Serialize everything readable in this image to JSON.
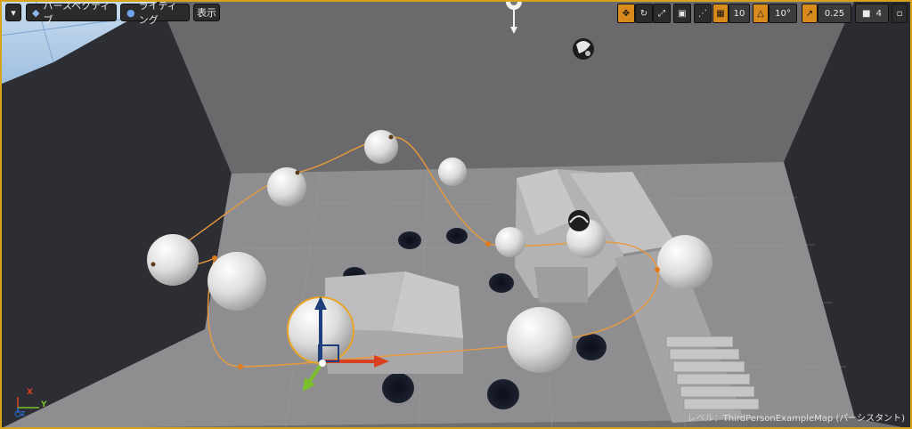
{
  "toolbar_left": {
    "menu_arrow": "▾",
    "perspective_label": "パースペクティブ",
    "lighting_label": "ライティング",
    "show_label": "表示"
  },
  "toolbar_right": {
    "grid_snap_value": "10",
    "rotation_snap_value": "10°",
    "scale_snap_value": "0.25",
    "camera_speed_value": "4"
  },
  "status": {
    "level_prefix": "レベル：",
    "level_name": "ThirdPersonExampleMap (パーシスタント)"
  },
  "axes": {
    "x": "X",
    "y": "Y",
    "z": "Z"
  },
  "colors": {
    "selection_border": "#d9a21b",
    "spline": "#e89a3c",
    "accent_orange": "#d88b1c",
    "gizmo_x": "#d94020",
    "gizmo_y": "#7cc02a",
    "gizmo_z": "#1f3f7a"
  }
}
